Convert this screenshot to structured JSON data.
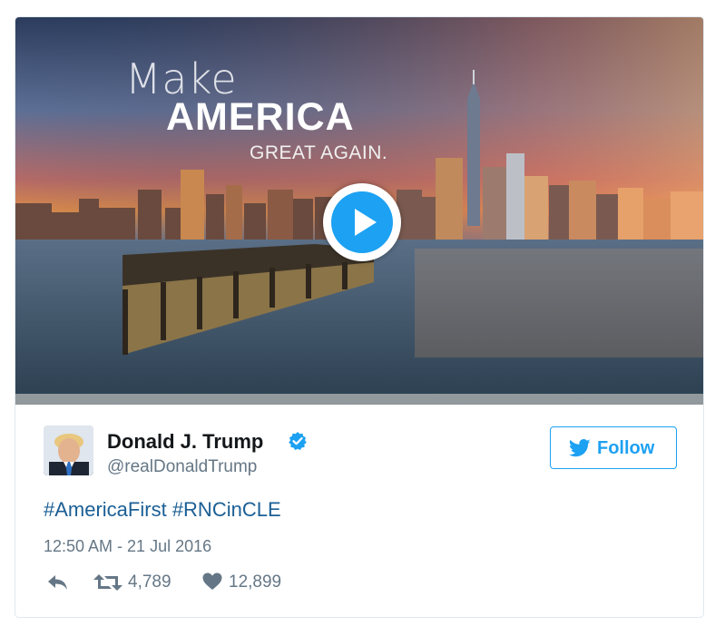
{
  "media": {
    "overlay": {
      "line1": "Make",
      "line2": "AMERICA",
      "line3": "GREAT AGAIN."
    }
  },
  "author": {
    "name": "Donald J. Trump",
    "handle": "@realDonaldTrump",
    "verified": true
  },
  "follow_button": {
    "label": "Follow"
  },
  "tweet": {
    "hashtags": [
      "#AmericaFirst",
      "#RNCinCLE"
    ],
    "timestamp": "12:50 AM - 21 Jul 2016"
  },
  "actions": {
    "retweets": "4,789",
    "likes": "12,899"
  },
  "colors": {
    "accent": "#1da1f2",
    "hashtag": "#1b5f95",
    "muted": "#657786",
    "text": "#14171a",
    "border": "#e1e8ed"
  },
  "icons": [
    "play-icon",
    "verified-badge-icon",
    "twitter-bird-icon",
    "reply-icon",
    "retweet-icon",
    "heart-icon"
  ]
}
